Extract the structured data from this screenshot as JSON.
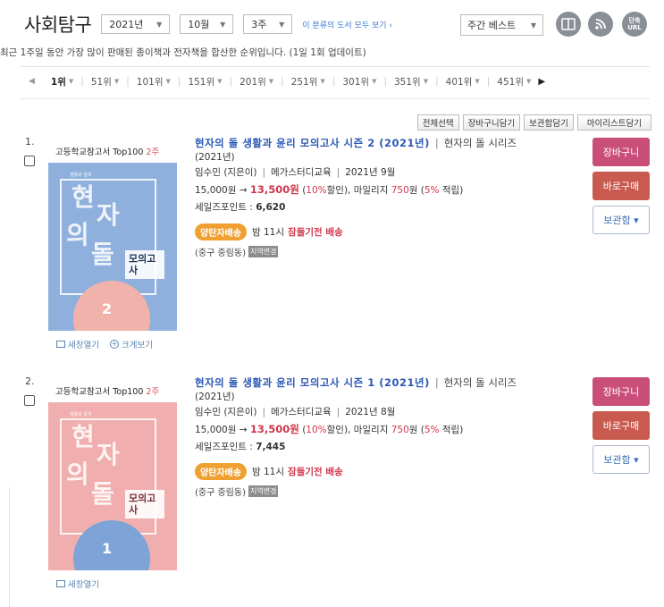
{
  "header": {
    "title": "사회탐구",
    "year_select": "2021년",
    "month_select": "10월",
    "week_select": "3주",
    "view_all_link": "이 분류의 도서 모두 보기 ›",
    "best_select": "주간 베스트",
    "icons": {
      "book": "book-icon",
      "rss": "rss-icon",
      "short_url": "단축 URL"
    }
  },
  "description": "최근 1주일 동안 가장 많이 판매된 종이책과 전자책을 합산한 순위입니다. (1일 1회 업데이트)",
  "pager": {
    "prev_icon": "◀",
    "next_icon": "▶",
    "items": [
      "1위",
      "51위",
      "101위",
      "151위",
      "201위",
      "251위",
      "301위",
      "351위",
      "401위",
      "451위"
    ]
  },
  "actions": [
    "전체선택",
    "장바구니담기",
    "보관함담기",
    "마이리스트담기"
  ],
  "items": [
    {
      "rank": "1.",
      "ribbon": "고등학교참고서 Top100",
      "ribbon_weeks": "2주",
      "cover_small": "생활과 윤리",
      "cover_chars": [
        "현",
        "자",
        "의",
        "돌"
      ],
      "cover_box": "모의고사",
      "cover_num": "2",
      "title": "현자의 돌 생활과 윤리 모의고사 시즌 2 (2021년)",
      "series": "현자의 돌 시리즈",
      "year_line": "(2021년)",
      "author": "임수민 (지은이)",
      "publisher": "메가스터디교육",
      "date": "2021년 9월",
      "price_orig": "15,000원 →",
      "price_sale": "13,500원",
      "discount": "10%",
      "discount_text": "할인), 마일리지",
      "mileage": "750",
      "mileage_pct": "5%",
      "mileage_tail": "적립)",
      "sales_label": "세일즈포인트 :",
      "sales_point": "6,620",
      "delivery_badge": "양탄자배송",
      "delivery_text": "밤 11시",
      "delivery_time": "잠들기전 배송",
      "region": "(중구 중림동)",
      "region_btn": "지역변경",
      "links": [
        "새창열기",
        "크게보기"
      ],
      "btn_cart": "장바구니",
      "btn_buy": "바로구매",
      "btn_box": "보관함 ▾"
    },
    {
      "rank": "2.",
      "ribbon": "고등학교참고서 Top100",
      "ribbon_weeks": "2주",
      "cover_small": "생활과 윤리",
      "cover_chars": [
        "현",
        "자",
        "의",
        "돌"
      ],
      "cover_box": "모의고사",
      "cover_num": "1",
      "title": "현자의 돌 생활과 윤리 모의고사 시즌 1 (2021년)",
      "series": "현자의 돌 시리즈",
      "year_line": "(2021년)",
      "author": "임수민 (지은이)",
      "publisher": "메가스터디교육",
      "date": "2021년 8월",
      "price_orig": "15,000원 →",
      "price_sale": "13,500원",
      "discount": "10%",
      "discount_text": "할인), 마일리지",
      "mileage": "750",
      "mileage_pct": "5%",
      "mileage_tail": "적립)",
      "sales_label": "세일즈포인트 :",
      "sales_point": "7,445",
      "delivery_badge": "양탄자배송",
      "delivery_text": "밤 11시",
      "delivery_time": "잠들기전 배송",
      "region": "(중구 중림동)",
      "region_btn": "지역변경",
      "links": [
        "새창열기"
      ],
      "btn_cart": "장바구니",
      "btn_buy": "바로구매",
      "btn_box": "보관함 ▾"
    }
  ]
}
